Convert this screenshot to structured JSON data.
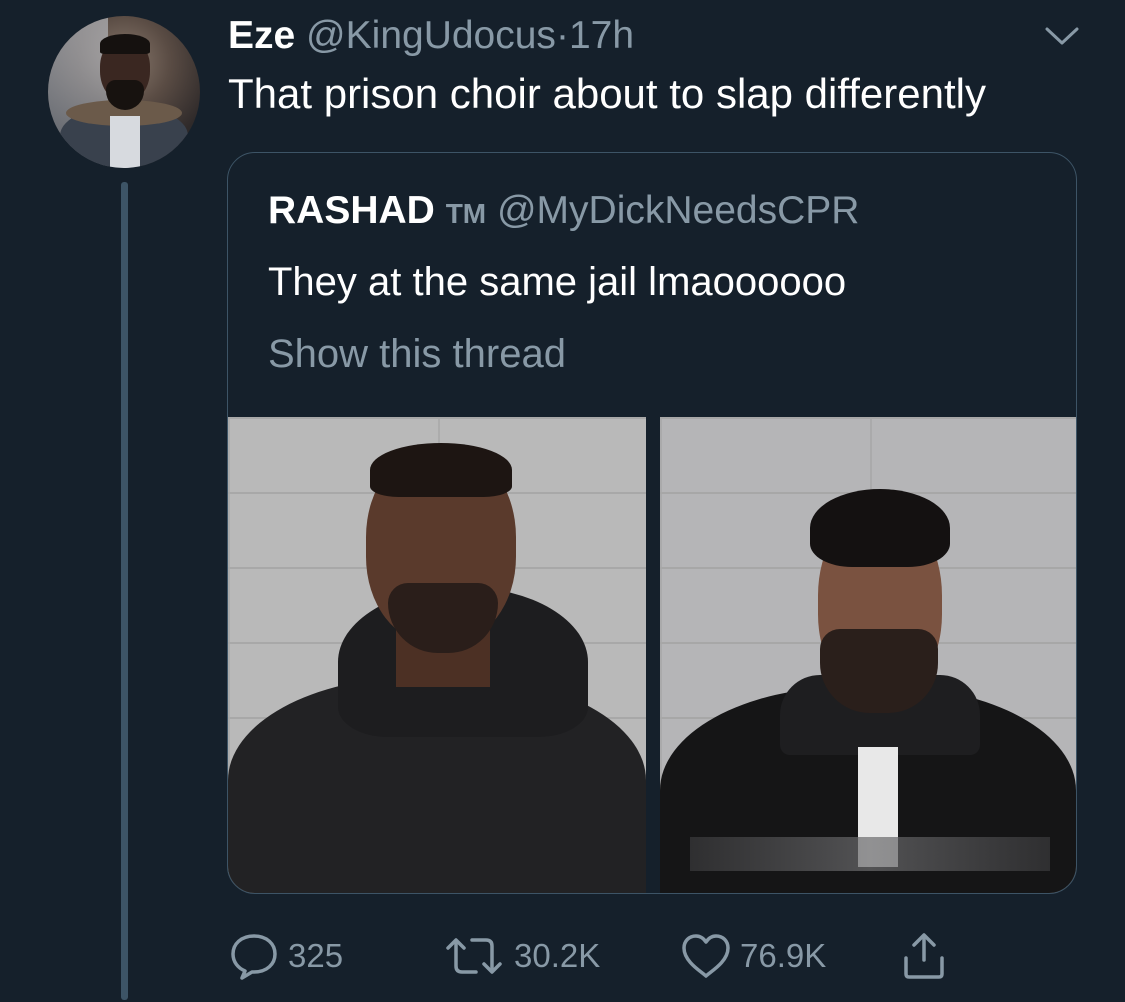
{
  "tweet": {
    "author_name": "Eze",
    "author_handle": "@KingUdocus",
    "separator": "·",
    "time": "17h",
    "text": "That prison choir about to slap differently"
  },
  "quoted_tweet": {
    "author_name": "RASHAD",
    "author_suffix": "TM",
    "author_handle": "@MyDickNeedsCPR",
    "text": "They at the same jail lmaoooooo",
    "show_thread": "Show this thread"
  },
  "actions": {
    "replies": "325",
    "retweets": "30.2K",
    "likes": "76.9K"
  },
  "icons": {
    "reply": "speech-bubble-icon",
    "retweet": "retweet-arrows-icon",
    "like": "heart-icon",
    "share": "share-upload-icon",
    "menu": "chevron-down-icon"
  },
  "colors": {
    "background": "#15202b",
    "secondary_text": "#8899a6",
    "border": "#3d5466"
  }
}
